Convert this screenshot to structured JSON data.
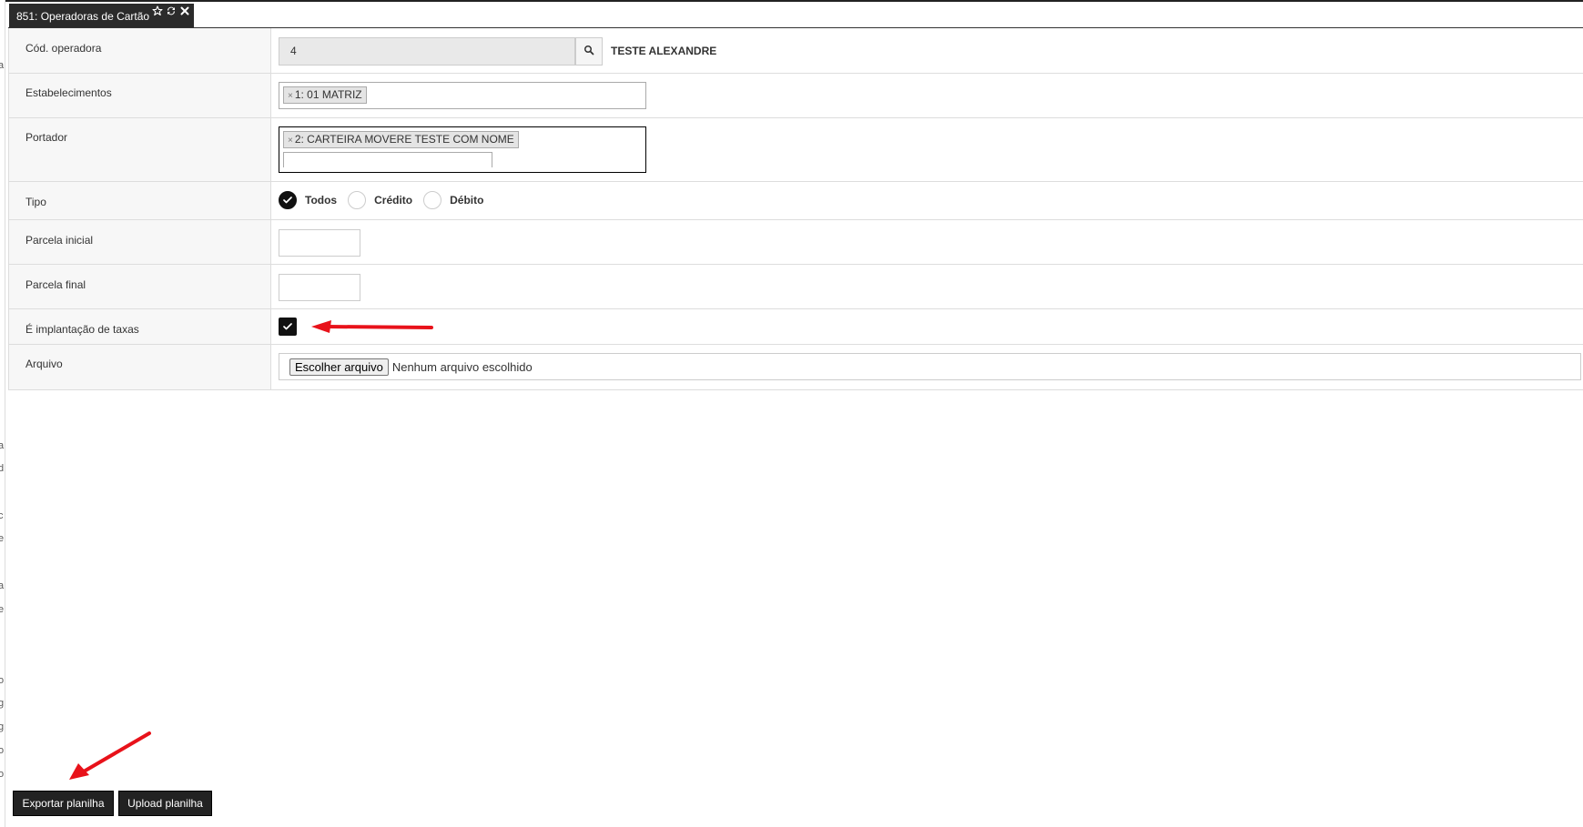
{
  "tab": {
    "title": "851: Operadoras de Cartão",
    "icons": [
      "star-icon",
      "refresh-icon",
      "close-icon"
    ]
  },
  "form": {
    "operadora": {
      "label": "Cód. operadora",
      "value": "4",
      "name": "TESTE ALEXANDRE"
    },
    "estabelecimentos": {
      "label": "Estabelecimentos",
      "chip": "1: 01 MATRIZ"
    },
    "portador": {
      "label": "Portador",
      "chip": "2: CARTEIRA MOVERE TESTE COM NOME"
    },
    "tipo": {
      "label": "Tipo",
      "options": [
        "Todos",
        "Crédito",
        "Débito"
      ],
      "selected": "Todos"
    },
    "parcela_inicial": {
      "label": "Parcela inicial",
      "value": ""
    },
    "parcela_final": {
      "label": "Parcela final",
      "value": ""
    },
    "implantacao": {
      "label": "É implantação de taxas",
      "checked": true
    },
    "arquivo": {
      "label": "Arquivo",
      "button": "Escolher arquivo",
      "status": "Nenhum arquivo escolhido"
    }
  },
  "actions": {
    "export": "Exportar planilha",
    "upload": "Upload planilha"
  },
  "gutter_chars": [
    "a",
    "a",
    "d",
    "c",
    "e",
    "a",
    "e",
    "o",
    "g",
    "g",
    "o",
    "o"
  ],
  "colors": {
    "annotation_arrow": "#e8121a",
    "dark": "#222222"
  }
}
